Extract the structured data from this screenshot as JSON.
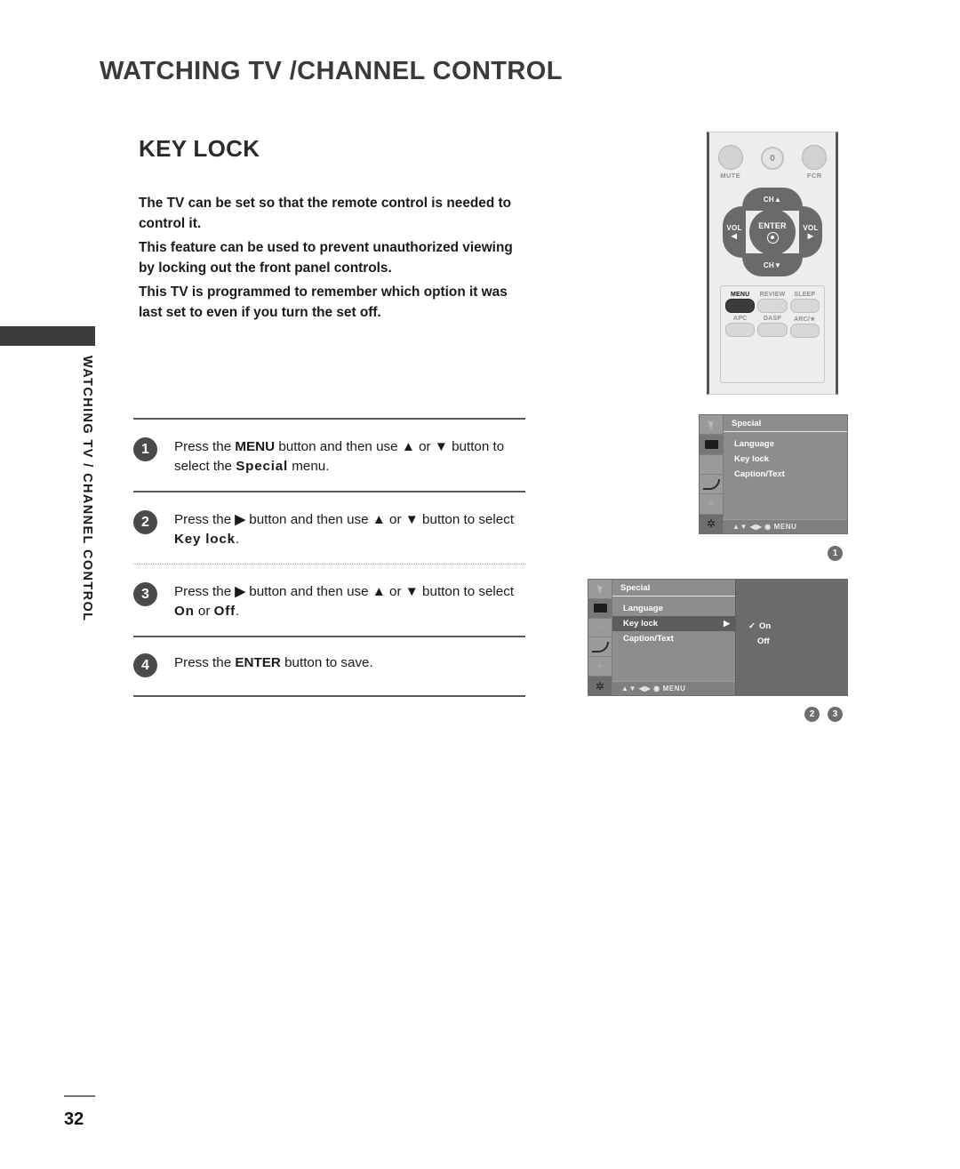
{
  "page": {
    "header_title": "WATCHING TV /CHANNEL CONTROL",
    "section_title": "KEY LOCK",
    "side_tab_text": "WATCHING TV / CHANNEL CONTROL",
    "page_number": "32"
  },
  "intro": {
    "p1": "The TV can be set so that the remote control is needed to control it.",
    "p2": "This feature can be used to prevent unauthorized viewing by locking out the front panel controls.",
    "p3": "This TV is programmed to remember which option it was last set to even if you turn the set off."
  },
  "steps": [
    {
      "number": "1",
      "t1": "Press the ",
      "b1": "MENU",
      "t2": " button and then use ",
      "b2": "▲",
      "t3": " or ",
      "b3": "▼",
      "t4": " button to select the ",
      "b4": "Special",
      "t5": " menu."
    },
    {
      "number": "2",
      "t1": "Press the ",
      "b1": "▶",
      "t2": " button and then use ",
      "b2": "▲",
      "t3": " or ",
      "b3": "▼",
      "t4": " button to select ",
      "b4": "Key lock",
      "t5": "."
    },
    {
      "number": "3",
      "t1": "Press the ",
      "b1": "▶",
      "t2": " button and then use ",
      "b2": "▲",
      "t3": " or ",
      "b3": "▼",
      "t4": " button to select ",
      "b4": "On",
      "t5": " or ",
      "b5": "Off",
      "t6": "."
    },
    {
      "number": "4",
      "t1": "Press the ",
      "b1": "ENTER",
      "t2": " button to save."
    }
  ],
  "remote": {
    "top_buttons": [
      {
        "label": "MUTE",
        "glyph": ""
      },
      {
        "label": "",
        "glyph": "0"
      },
      {
        "label": "FCR",
        "glyph": ""
      }
    ],
    "dpad": {
      "up": "CH▲",
      "down": "CH▼",
      "left_l1": "VOL",
      "left_l2": "◀",
      "right_l1": "VOL",
      "right_l2": "▶",
      "center": "ENTER"
    },
    "panel_buttons": [
      {
        "label": "MENU",
        "highlighted": true
      },
      {
        "label": "REVIEW",
        "highlighted": false
      },
      {
        "label": "SLEEP",
        "highlighted": false
      },
      {
        "label": "APC",
        "highlighted": false
      },
      {
        "label": "DASP",
        "highlighted": false
      },
      {
        "label": "ARC/★",
        "highlighted": false
      }
    ]
  },
  "osd1": {
    "title": "Special",
    "items": [
      "Language",
      "Key lock",
      "Caption/Text"
    ],
    "footer": "▲▼  ◀▶  ◉  MENU",
    "badge": "1"
  },
  "osd2": {
    "title": "Special",
    "items": [
      {
        "label": "Language",
        "highlighted": false,
        "arrow": ""
      },
      {
        "label": "Key lock",
        "highlighted": true,
        "arrow": "▶"
      },
      {
        "label": "Caption/Text",
        "highlighted": false,
        "arrow": ""
      }
    ],
    "footer": "▲▼  ◀▶  ◉  MENU",
    "submenu": [
      {
        "check": "✓",
        "label": "On",
        "selected": true
      },
      {
        "check": "",
        "label": "Off",
        "selected": false
      }
    ],
    "badge_a": "2",
    "badge_b": "3"
  },
  "colors": {
    "header_gray": "#3a3a3a",
    "badge_gray": "#4a4a4a",
    "osd_bg": "#8d8d8d",
    "osd_highlight": "#5d5d5d",
    "remote_body": "#ededed",
    "remote_key_active": "#3b3b3b"
  }
}
